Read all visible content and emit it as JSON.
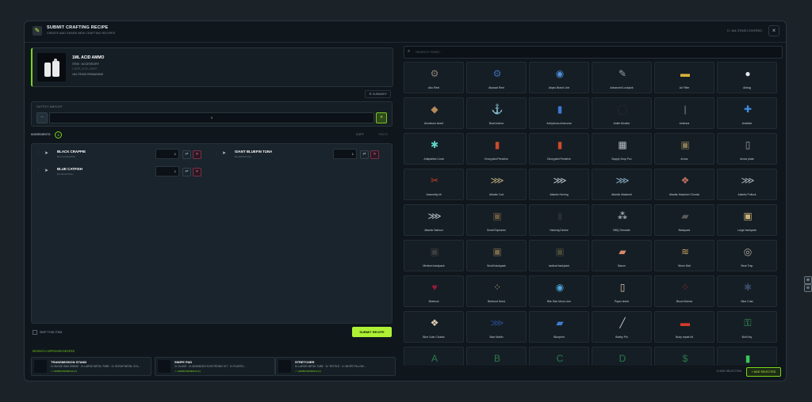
{
  "header": {
    "title": "SUBMIT CRAFTING RECIPE",
    "subtitle": "CREATE AND SHARE NEW CRAFTING RECIPES",
    "right_text": "0 / 164 ITEMS COVERED",
    "close": "×"
  },
  "item": {
    "name": "1ML ACID AMMO",
    "type": "ITEM · ACCESSORY",
    "sub": "LASER_ACID_AMMO",
    "remaining": "164 ITEMS REMAINING"
  },
  "summary": "☰ SUMMARY",
  "output": {
    "label": "OUTPUT AMOUNT",
    "value": "1",
    "minus": "−",
    "plus": "+"
  },
  "ingredients": {
    "label": "INGREDIENTS",
    "count": "3",
    "copy": "COPY",
    "paste": "PASTE",
    "rows": [
      {
        "name": "BLACK CRAPPIE",
        "id": "BLACKCRAPPIE",
        "qty": "1"
      },
      {
        "name": "GIANT BLUEFIN TUNA",
        "id": "BLUEFINTUNA",
        "qty": "1"
      },
      {
        "name": "BLUE CATFISH",
        "id": "BLUECATFISH",
        "qty": "1"
      }
    ]
  },
  "skip": "SKIP THIS ITEM",
  "submit": "SUBMIT RECIPE",
  "recent": {
    "label": "RECENTLY APPROVED RECIPES",
    "cards": [
      {
        "name": "TRANSMISSION STAND",
        "desc": "2× BLOOD BAG SWIMS · 2× LARGE METAL TUBE · 2× SCRAP METAL COL...",
        "user": "✓ HARBOURMENJA  (2)"
      },
      {
        "name": "SWIPE PAD",
        "desc": "2× GLASS · 2× ADVANCED ELECTRONIC KIT · 2× PLASTIC ...",
        "user": "✓ HARBOURMENJA  (2)"
      },
      {
        "name": "STRETCHER",
        "desc": "5× LARGE METAL TUBE · 3× TEXTILE · 1× WHITE PILLOW ...",
        "user": "✓ HARBOURMENJA  (2)"
      }
    ]
  },
  "search": {
    "placeholder": "SEARCH ITEMS..."
  },
  "tiles": [
    {
      "label": "Abu Reel",
      "icon": "⚙",
      "color": "#8a8070"
    },
    {
      "label": "Abyssal Reel",
      "icon": "⚙",
      "color": "#3b6db5"
    },
    {
      "label": "Abyss Brand Line",
      "icon": "◉",
      "color": "#4e8ed8"
    },
    {
      "label": "Advanced Lockpick",
      "icon": "✎",
      "color": "#9aa0a6"
    },
    {
      "label": "Air Filter",
      "icon": "▬",
      "color": "#d9b23a"
    },
    {
      "label": "Airbag",
      "icon": "●",
      "color": "#e4e6e8"
    },
    {
      "label": "Aluminum sheet",
      "icon": "◆",
      "color": "#b58a58"
    },
    {
      "label": "Boat Anchor",
      "icon": "⚓",
      "color": "#e8eaec"
    },
    {
      "label": "Anhydrous Ammonia",
      "icon": "▮",
      "color": "#3d78d0"
    },
    {
      "label": "Ankle Monitor",
      "icon": "◯",
      "color": "#2a2a2a"
    },
    {
      "label": "Antenna",
      "icon": "|",
      "color": "#888"
    },
    {
      "label": "Antidote",
      "icon": "✚",
      "color": "#3e8ee0"
    },
    {
      "label": "Antipathes Coral",
      "icon": "✱",
      "color": "#5ed6c8"
    },
    {
      "label": "Encrypted Pendrive",
      "icon": "▮",
      "color": "#cc4a2a"
    },
    {
      "label": "Decrypted Pendrive",
      "icon": "▮",
      "color": "#cc4a2a"
    },
    {
      "label": "Supply Drop Pox",
      "icon": "▦",
      "color": "#b8bec4"
    },
    {
      "label": "Armor",
      "icon": "▣",
      "color": "#8a7a52"
    },
    {
      "label": "Armor plate",
      "icon": "▯",
      "color": "#9a9ea2"
    },
    {
      "label": "Assembly kit",
      "icon": "✂",
      "color": "#cc3a2a"
    },
    {
      "label": "Atlantic Cod",
      "icon": "⋙",
      "color": "#b8a878"
    },
    {
      "label": "Atlantic Herring",
      "icon": "⋙",
      "color": "#b8c4cc"
    },
    {
      "label": "Atlantic Mackerel",
      "icon": "⋙",
      "color": "#8ab0c4"
    },
    {
      "label": "Atlantic Mackerel Chunks",
      "icon": "❖",
      "color": "#c07060"
    },
    {
      "label": "Atlantic Pollock",
      "icon": "⋙",
      "color": "#a8b4bc"
    },
    {
      "label": "Atlantic Salmon",
      "icon": "⋙",
      "color": "#b8c4cc"
    },
    {
      "label": "Small Explosive",
      "icon": "▣",
      "color": "#6a5a40"
    },
    {
      "label": "Hacking Device",
      "icon": "▮",
      "color": "#2a2e30"
    },
    {
      "label": "BBQ Grenade",
      "icon": "⁂",
      "color": "#cfd4d8"
    },
    {
      "label": "Backpack",
      "icon": "▰",
      "color": "#5a5a5a"
    },
    {
      "label": "Large backpack",
      "icon": "▣",
      "color": "#c8b078"
    },
    {
      "label": "Medium backpack",
      "icon": "▣",
      "color": "#3e3e3e"
    },
    {
      "label": "Small backpack",
      "icon": "▣",
      "color": "#7a6a4a"
    },
    {
      "label": "tactical backpack",
      "icon": "▣",
      "color": "#4a4a3a"
    },
    {
      "label": "Bacon",
      "icon": "▰",
      "color": "#d88a6a"
    },
    {
      "label": "Worm Bait",
      "icon": "≋",
      "color": "#c8a060"
    },
    {
      "label": "Bear Trap",
      "icon": "◎",
      "color": "#b8b0a0"
    },
    {
      "label": "Beetroot",
      "icon": "♥",
      "color": "#9a1a3a"
    },
    {
      "label": "Beetroot Seed",
      "icon": "⁘",
      "color": "#b89a6a"
    },
    {
      "label": "Bite Size Mono Line",
      "icon": "◉",
      "color": "#4ea6d8"
    },
    {
      "label": "Paper sheet",
      "icon": "▯",
      "color": "#e0c8a8"
    },
    {
      "label": "Blood Worms",
      "icon": "⁘",
      "color": "#b82a2a"
    },
    {
      "label": "Blue Crab",
      "icon": "✱",
      "color": "#3a4a6a"
    },
    {
      "label": "Blue Crab Chunks",
      "icon": "❖",
      "color": "#e0d0b0"
    },
    {
      "label": "Blue Marlin",
      "icon": "⋙",
      "color": "#2a4a8a"
    },
    {
      "label": "Blueprint",
      "icon": "▰",
      "color": "#3e7ed0"
    },
    {
      "label": "Bobby Pin",
      "icon": "╱",
      "color": "#c8c8c8"
    },
    {
      "label": "Body repair kit",
      "icon": "▬",
      "color": "#d83a2a"
    },
    {
      "label": "Bolt Key",
      "icon": "⚿",
      "color": "#3aa85a"
    },
    {
      "label": "",
      "icon": "A",
      "color": "#2a7a4a"
    },
    {
      "label": "",
      "icon": "B",
      "color": "#2a7a4a"
    },
    {
      "label": "",
      "icon": "C",
      "color": "#2a7a4a"
    },
    {
      "label": "",
      "icon": "D",
      "color": "#2a7a4a"
    },
    {
      "label": "",
      "icon": "$",
      "color": "#2a7a4a"
    },
    {
      "label": "",
      "icon": "▮",
      "color": "#3ac85a"
    }
  ],
  "footer": {
    "clear": "CLEAR SELECTION",
    "add": "+ ADD SELECTED"
  },
  "side": {
    "top": "⊕",
    "bottom": "⊖"
  }
}
